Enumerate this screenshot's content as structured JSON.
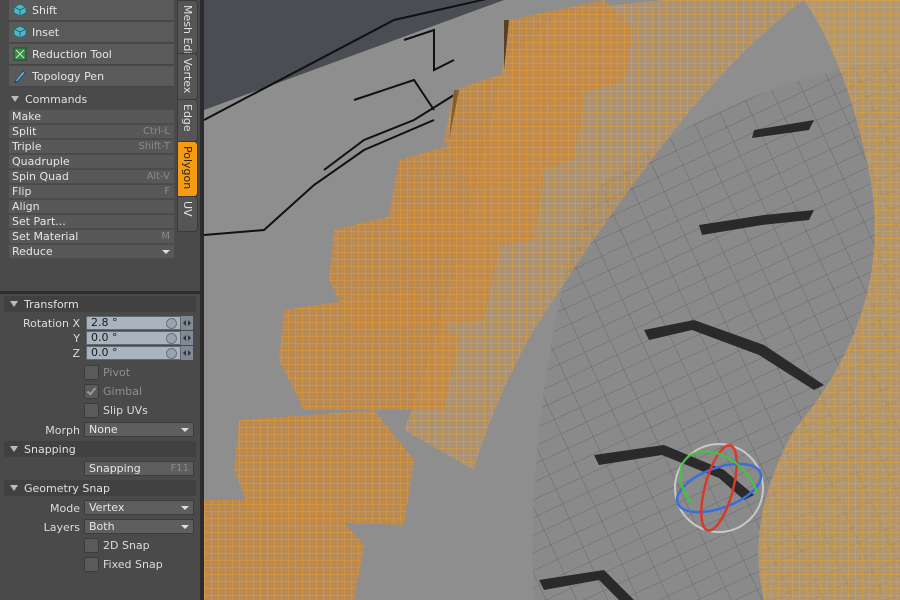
{
  "tools": [
    {
      "label": "Shift",
      "icon": "cube-icon"
    },
    {
      "label": "Inset",
      "icon": "cube-icon"
    },
    {
      "label": "Reduction Tool",
      "icon": "reduction-icon"
    },
    {
      "label": "Topology Pen",
      "icon": "pen-icon"
    }
  ],
  "vertical_tabs": [
    {
      "label": "Mesh Edit",
      "active": false
    },
    {
      "label": "Vertex",
      "active": false
    },
    {
      "label": "Edge",
      "active": false
    },
    {
      "label": "Polygon",
      "active": true
    },
    {
      "label": "UV",
      "active": false
    }
  ],
  "commands": {
    "header": "Commands",
    "items": [
      {
        "label": "Make",
        "shortcut": ""
      },
      {
        "label": "Split",
        "shortcut": "Ctrl-L"
      },
      {
        "label": "Triple",
        "shortcut": "Shift-T"
      },
      {
        "label": "Quadruple",
        "shortcut": ""
      },
      {
        "label": "Spin Quad",
        "shortcut": "Alt-V"
      },
      {
        "label": "Flip",
        "shortcut": "F"
      },
      {
        "label": "Align",
        "shortcut": ""
      },
      {
        "label": "Set Part...",
        "shortcut": ""
      },
      {
        "label": "Set Material",
        "shortcut": "M"
      },
      {
        "label": "Reduce",
        "shortcut": ""
      }
    ]
  },
  "transform": {
    "header": "Transform",
    "rotation_label": "Rotation X",
    "y_label": "Y",
    "z_label": "Z",
    "rotation_x": "2.8 °",
    "rotation_y": "0.0 °",
    "rotation_z": "0.0 °",
    "pivot_label": "Pivot",
    "gimbal_label": "Gimbal",
    "gimbal_checked": true,
    "slip_uvs_label": "Slip UVs",
    "morph_label": "Morph",
    "morph_value": "None"
  },
  "snapping": {
    "header": "Snapping",
    "button_label": "Snapping",
    "shortcut": "F11"
  },
  "geometry_snap": {
    "header": "Geometry Snap",
    "mode_label": "Mode",
    "mode_value": "Vertex",
    "layers_label": "Layers",
    "layers_value": "Both",
    "snap2d_label": "2D Snap",
    "fixed_snap_label": "Fixed Snap"
  },
  "colors": {
    "accent": "#f59b14",
    "wireframe": "#f5a623",
    "panel": "#4a4a4a",
    "field": "#aab4c0",
    "gizmo_red": "#d83a2a",
    "gizmo_green": "#3cc83c",
    "gizmo_blue": "#3a6ee0"
  }
}
